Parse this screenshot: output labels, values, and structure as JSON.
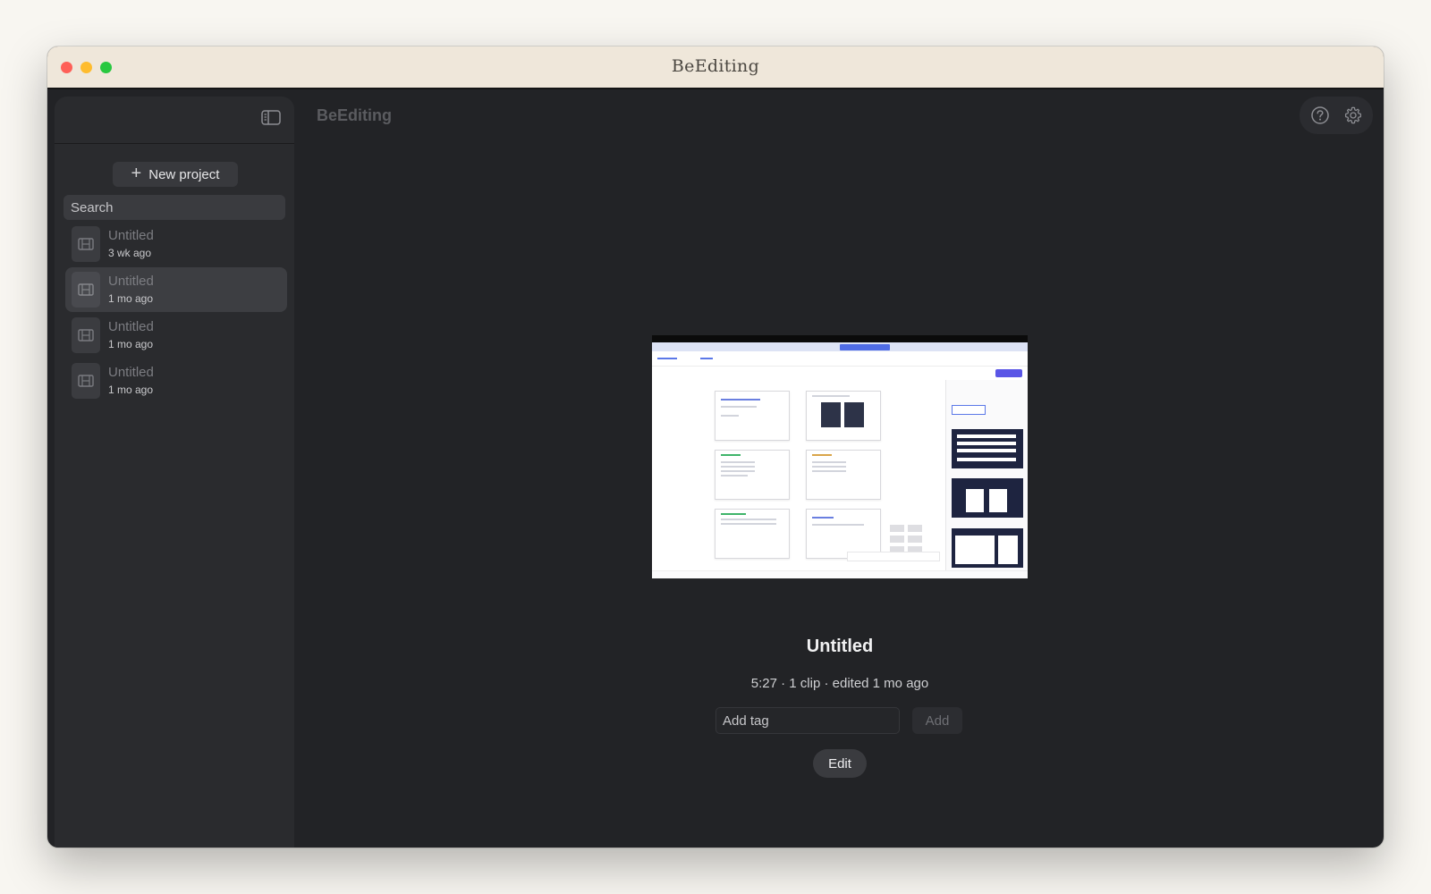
{
  "window": {
    "title": "BeEditing"
  },
  "app": {
    "title": "BeEditing"
  },
  "sidebar": {
    "new_project_label": "New project",
    "search_placeholder": "Search",
    "projects": [
      {
        "name": "Untitled",
        "time": "3 wk ago",
        "selected": false
      },
      {
        "name": "Untitled",
        "time": "1 mo ago",
        "selected": true
      },
      {
        "name": "Untitled",
        "time": "1 mo ago",
        "selected": false
      },
      {
        "name": "Untitled",
        "time": "1 mo ago",
        "selected": false
      }
    ]
  },
  "detail": {
    "title": "Untitled",
    "meta": "5:27 · 1 clip · edited 1 mo ago",
    "tag_placeholder": "Add tag",
    "add_label": "Add",
    "edit_label": "Edit"
  },
  "icons": {
    "sidebar_toggle": "sidebar-toggle-icon",
    "help": "help-icon",
    "settings": "gear-icon",
    "project_thumb": "film-icon",
    "plus": "plus-icon"
  },
  "colors": {
    "traffic_red": "#fe5f57",
    "traffic_yellow": "#febc2e",
    "traffic_green": "#28c840",
    "titlebar": "#efe7da",
    "background": "#222326",
    "sidebar": "#2a2b2e",
    "selected_item": "#3d3e42"
  }
}
